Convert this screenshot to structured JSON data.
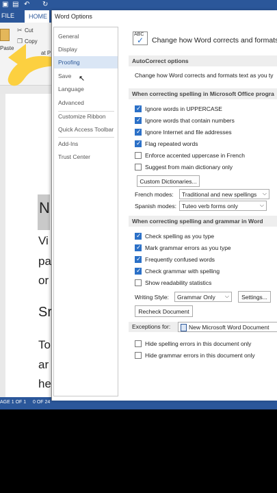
{
  "word": {
    "tabs": {
      "file": "FILE",
      "home": "HOME"
    },
    "clipboard": {
      "paste": "Paste",
      "cut": "Cut",
      "copy": "Copy",
      "format_painter": "at P"
    },
    "doc_text": [
      "N",
      "Vi",
      "pa",
      "or",
      "Sr",
      "To",
      "ar",
      "he"
    ],
    "status": {
      "page": "AGE 1 OF 1",
      "words": "0 OF 24"
    }
  },
  "dialog": {
    "title": "Word Options",
    "nav": [
      "General",
      "Display",
      "Proofing",
      "Save",
      "Language",
      "Advanced",
      "Customize Ribbon",
      "Quick Access Toolbar",
      "Add-Ins",
      "Trust Center"
    ],
    "selected_nav": "Proofing",
    "heading": "Change how Word corrects and formats y",
    "abc_icon": "ABC",
    "sections": {
      "autocorrect": {
        "title": "AutoCorrect options",
        "text": "Change how Word corrects and formats text as you ty"
      },
      "office": {
        "title": "When correcting spelling in Microsoft Office progra",
        "options": [
          {
            "label": "Ignore words in UPPERCASE",
            "checked": true
          },
          {
            "label": "Ignore words that contain numbers",
            "checked": true
          },
          {
            "label": "Ignore Internet and file addresses",
            "checked": true
          },
          {
            "label": "Flag repeated words",
            "checked": true
          },
          {
            "label": "Enforce accented uppercase in French",
            "checked": false
          },
          {
            "label": "Suggest from main dictionary only",
            "checked": false
          }
        ],
        "custom_dict_button": "Custom Dictionaries...",
        "french_modes": {
          "label": "French modes:",
          "value": "Traditional and new spellings"
        },
        "spanish_modes": {
          "label": "Spanish modes:",
          "value": "Tuteo verb forms only"
        }
      },
      "word": {
        "title": "When correcting spelling and grammar in Word",
        "options": [
          {
            "label": "Check spelling as you type",
            "checked": true
          },
          {
            "label": "Mark grammar errors as you type",
            "checked": true
          },
          {
            "label": "Frequently confused words",
            "checked": true
          },
          {
            "label": "Check grammar with spelling",
            "checked": true
          },
          {
            "label": "Show readability statistics",
            "checked": false
          }
        ],
        "writing_style": {
          "label": "Writing Style:",
          "value": "Grammar Only"
        },
        "settings_button": "Settings...",
        "recheck_button": "Recheck Document"
      },
      "exceptions": {
        "label": "Exceptions for:",
        "value": "New Microsoft Word Document",
        "options": [
          {
            "label": "Hide spelling errors in this document only",
            "checked": false
          },
          {
            "label": "Hide grammar errors in this document only",
            "checked": false
          }
        ]
      }
    }
  },
  "colors": {
    "word_blue": "#2b579a",
    "nav_selected": "#dae6f5",
    "checkbox_on": "#2b70c7",
    "annotation": "#fcd040"
  }
}
